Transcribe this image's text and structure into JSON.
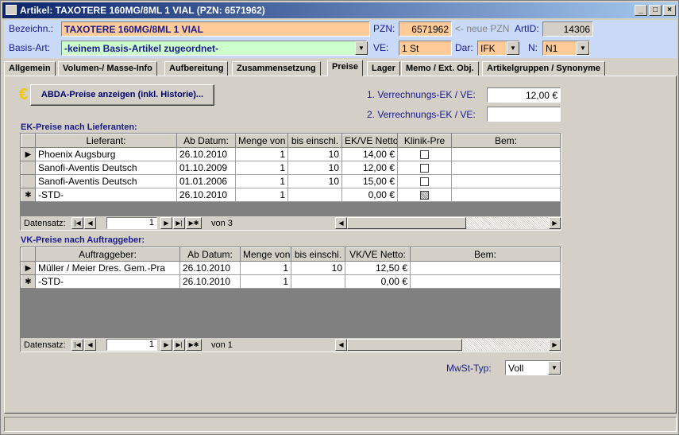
{
  "window": {
    "title": "Artikel: TAXOTERE 160MG/8ML 1 VIAL (PZN: 6571962)"
  },
  "header": {
    "bezeichn_label": "Bezeichn.:",
    "bezeichn_value": "TAXOTERE 160MG/8ML 1 VIAL",
    "pzn_label": "PZN:",
    "pzn_value": "6571962",
    "neue_pzn": "<- neue PZN",
    "artid_label": "ArtID:",
    "artid_value": "14306",
    "basis_label": "Basis-Art:",
    "basis_value": "-keinem Basis-Artikel zugeordnet-",
    "ve_label": "VE:",
    "ve_value": "1 St",
    "dar_label": "Dar:",
    "dar_value": "IFK",
    "n_label": "N:",
    "n_value": "N1"
  },
  "tabs": [
    "Allgemein",
    "Volumen-/ Masse-Info",
    "Aufbereitung",
    "Zusammensetzung",
    "Preise",
    "Lager",
    "Memo / Ext. Obj.",
    "Artikelgruppen / Synonyme"
  ],
  "active_tab": "Preise",
  "abda_button": "ABDA-Preise anzeigen (inkl. Historie)...",
  "verrechnung1_label": "1. Verrechnungs-EK / VE:",
  "verrechnung1_value": "12,00 €",
  "verrechnung2_label": "2. Verrechnungs-EK / VE:",
  "verrechnung2_value": "",
  "ek": {
    "title": "EK-Preise nach Lieferanten:",
    "columns": [
      "Lieferant:",
      "Ab Datum:",
      "Menge von",
      "bis einschl.",
      "EK/VE  Netto:",
      "Klinik-Pre",
      "Bem:"
    ],
    "rows": [
      {
        "sel": "▶",
        "lieferant": "Phoenix Augsburg",
        "datum": "26.10.2010",
        "von": "1",
        "bis": "10",
        "netto": "14,00 €"
      },
      {
        "sel": "",
        "lieferant": "Sanofi-Aventis Deutsch",
        "datum": "01.10.2009",
        "von": "1",
        "bis": "10",
        "netto": "12,00 €"
      },
      {
        "sel": "",
        "lieferant": "Sanofi-Aventis Deutsch",
        "datum": "01.01.2006",
        "von": "1",
        "bis": "10",
        "netto": "15,00 €"
      },
      {
        "sel": "✱",
        "lieferant": "-STD-",
        "datum": "26.10.2010",
        "von": "1",
        "bis": "",
        "netto": "0,00 €"
      }
    ],
    "nav_label": "Datensatz:",
    "nav_value": "1",
    "nav_of": "von  3"
  },
  "vk": {
    "title": "VK-Preise nach Auftraggeber:",
    "columns": [
      "Auftraggeber:",
      "Ab Datum:",
      "Menge von",
      "bis einschl.",
      "VK/VE Netto:",
      "Bem:"
    ],
    "rows": [
      {
        "sel": "▶",
        "auftraggeber": "Müller / Meier Dres. Gem.-Pra",
        "datum": "26.10.2010",
        "von": "1",
        "bis": "10",
        "netto": "12,50 €"
      },
      {
        "sel": "✱",
        "auftraggeber": "-STD-",
        "datum": "26.10.2010",
        "von": "1",
        "bis": "",
        "netto": "0,00 €"
      }
    ],
    "nav_label": "Datensatz:",
    "nav_value": "1",
    "nav_of": "von  1"
  },
  "mwst_label": "MwSt-Typ:",
  "mwst_value": "Voll",
  "colors": {
    "header_bg": "#c9daf8",
    "orange_field": "#ffcc99",
    "green_field": "#ccffcc",
    "gray_field": "#d4d0c8"
  }
}
